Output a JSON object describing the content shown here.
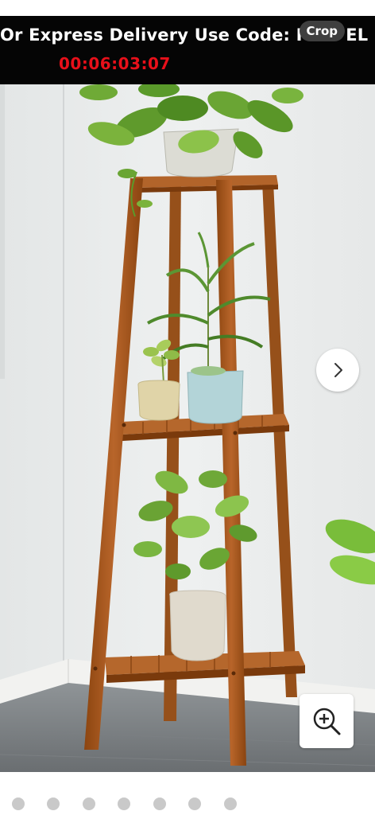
{
  "banner": {
    "promo_text": "Or Express Delivery Use Code: F",
    "promo_text_tail": "EL",
    "timer": "00:06:03:07",
    "crop_label": "Crop"
  },
  "gallery": {
    "product": "tiered wooden plant stand with potted plants",
    "dot_count": 7,
    "icons": {
      "next": "chevron-right-icon",
      "zoom": "zoom-in-icon"
    }
  },
  "colors": {
    "banner_bg": "#050505",
    "timer": "#e8101a",
    "wood": "#a8581c",
    "dot": "#c9c9c9"
  }
}
